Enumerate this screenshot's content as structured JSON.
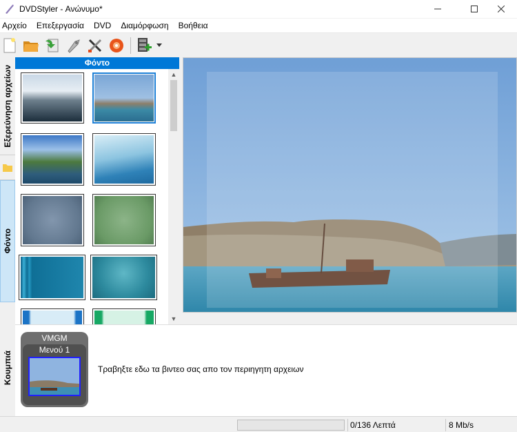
{
  "window": {
    "title": "DVDStyler - Ανώνυμο*",
    "minimize_glyph": "—",
    "maximize_glyph": "☐",
    "close_glyph": "✕"
  },
  "menu": [
    "Αρχείο",
    "Επεξεργασία",
    "DVD",
    "Διαμόρφωση",
    "Βοήθεια"
  ],
  "toolbar": {
    "icons": [
      "new-icon",
      "open-icon",
      "save-icon",
      "burn-icon",
      "settings-icon",
      "disc-icon",
      "add-video-icon"
    ]
  },
  "side_tabs": {
    "explorer": "Εξερεύνηση αρχείων",
    "backgrounds": "Φόντο",
    "buttons": "Κουμπιά"
  },
  "panel": {
    "title": "Φόντο"
  },
  "bottom": {
    "vmgm_label": "VMGM",
    "menu_label": "Μενού 1",
    "drop_hint": "Τραβηξτε εδω τα βιντεο σας απο τον περιηγητη αρχειων"
  },
  "status": {
    "duration": "0/136 Λεπτά",
    "bitrate": "8 Mb/s"
  },
  "colors": {
    "accent": "#0078d7",
    "selection": "#1c7fd6"
  }
}
